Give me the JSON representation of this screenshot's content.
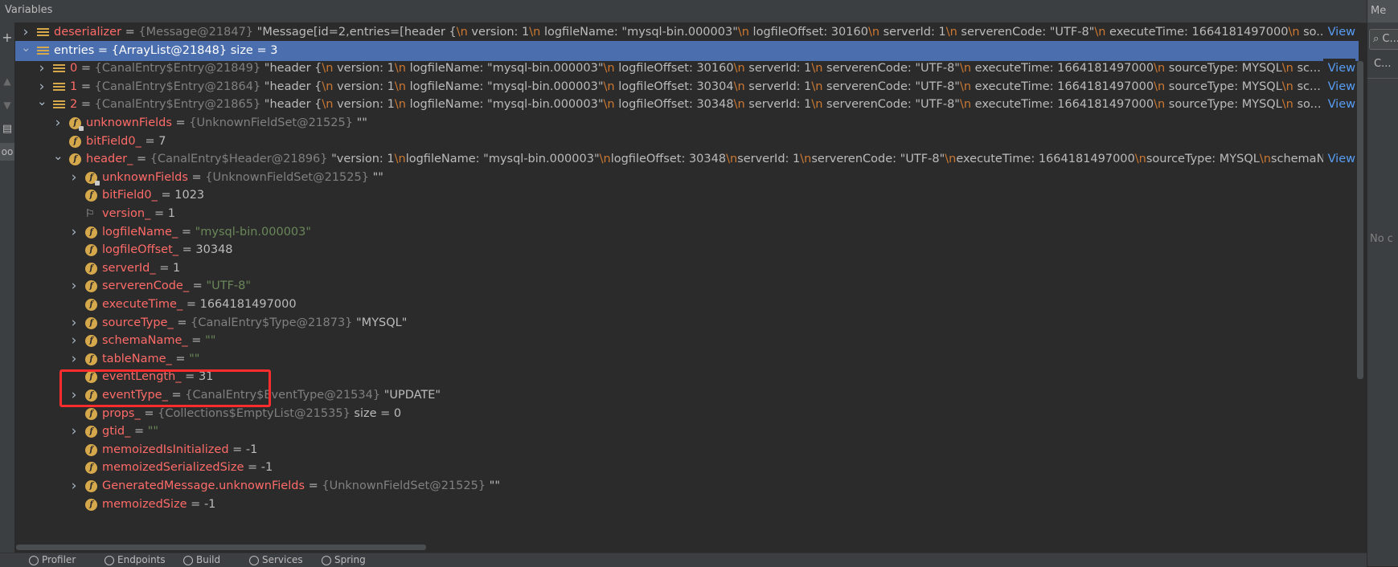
{
  "panel": {
    "title": "Variables"
  },
  "right_panel": {
    "tab": "Me",
    "search_text": "C...",
    "item": "C...",
    "empty_text": "No c"
  },
  "view_link": "View",
  "rows": [
    {
      "indent": 0,
      "arrow": "right",
      "icon": "list",
      "name": "deserializer",
      "ref": "{Message@21847}",
      "val": "\"Message[id=2,entries=[header {\\n  version: 1\\n  logfileName: \"mysql-bin.000003\"\\n  logfileOffset: 30160\\n  serverId: 1\\n  serverenCode: \"UTF-8\"\\n  executeTime: 1664181497000\\n  so...",
      "view": true
    },
    {
      "indent": 0,
      "arrow": "down",
      "icon": "list",
      "name": "entries",
      "ref": "{ArrayList@21848}",
      "val": "size = 3",
      "sel": true
    },
    {
      "indent": 1,
      "arrow": "right",
      "icon": "list",
      "name": "0",
      "ref": "{CanalEntry$Entry@21849}",
      "val": "\"header {\\n  version: 1\\n  logfileName: \"mysql-bin.000003\"\\n  logfileOffset: 30160\\n  serverId: 1\\n  serverenCode: \"UTF-8\"\\n  executeTime: 1664181497000\\n  sourceType: MYSQL\\n  sc...",
      "view": true
    },
    {
      "indent": 1,
      "arrow": "right",
      "icon": "list",
      "name": "1",
      "ref": "{CanalEntry$Entry@21864}",
      "val": "\"header {\\n  version: 1\\n  logfileName: \"mysql-bin.000003\"\\n  logfileOffset: 30304\\n  serverId: 1\\n  serverenCode: \"UTF-8\"\\n  executeTime: 1664181497000\\n  sourceType: MYSQL\\n  sc...",
      "view": true
    },
    {
      "indent": 1,
      "arrow": "down",
      "icon": "list",
      "name": "2",
      "ref": "{CanalEntry$Entry@21865}",
      "val": "\"header {\\n  version: 1\\n  logfileName: \"mysql-bin.000003\"\\n  logfileOffset: 30348\\n  serverId: 1\\n  serverenCode: \"UTF-8\"\\n  executeTime: 1664181497000\\n  sourceType: MYSQL\\n  so...",
      "view": true
    },
    {
      "indent": 2,
      "arrow": "right",
      "icon": "f-lock",
      "name": "unknownFields",
      "ref": "{UnknownFieldSet@21525}",
      "val": "\"\""
    },
    {
      "indent": 2,
      "arrow": "",
      "icon": "f",
      "name": "bitField0_",
      "ref": "",
      "val": "7"
    },
    {
      "indent": 2,
      "arrow": "down",
      "icon": "f",
      "name": "header_",
      "ref": "{CanalEntry$Header@21896}",
      "val": "\"version: 1\\nlogfileName: \"mysql-bin.000003\"\\nlogfileOffset: 30348\\nserverId: 1\\nserverenCode: \"UTF-8\"\\nexecuteTime: 1664181497000\\nsourceType: MYSQL\\nschemaN...",
      "view": true
    },
    {
      "indent": 3,
      "arrow": "right",
      "icon": "f-lock",
      "name": "unknownFields",
      "ref": "{UnknownFieldSet@21525}",
      "val": "\"\""
    },
    {
      "indent": 3,
      "arrow": "",
      "icon": "f",
      "name": "bitField0_",
      "ref": "",
      "val": "1023"
    },
    {
      "indent": 3,
      "arrow": "",
      "icon": "flag",
      "name": "version_",
      "ref": "",
      "val": "1"
    },
    {
      "indent": 3,
      "arrow": "right",
      "icon": "f",
      "name": "logfileName_",
      "ref": "",
      "val": "\"mysql-bin.000003\"",
      "str": true
    },
    {
      "indent": 3,
      "arrow": "",
      "icon": "f",
      "name": "logfileOffset_",
      "ref": "",
      "val": "30348"
    },
    {
      "indent": 3,
      "arrow": "",
      "icon": "f",
      "name": "serverId_",
      "ref": "",
      "val": "1"
    },
    {
      "indent": 3,
      "arrow": "right",
      "icon": "f",
      "name": "serverenCode_",
      "ref": "",
      "val": "\"UTF-8\"",
      "str": true
    },
    {
      "indent": 3,
      "arrow": "",
      "icon": "f",
      "name": "executeTime_",
      "ref": "",
      "val": "1664181497000"
    },
    {
      "indent": 3,
      "arrow": "right",
      "icon": "f",
      "name": "sourceType_",
      "ref": "{CanalEntry$Type@21873}",
      "val": "\"MYSQL\""
    },
    {
      "indent": 3,
      "arrow": "right",
      "icon": "f",
      "name": "schemaName_",
      "ref": "",
      "val": "\"\"",
      "str": true
    },
    {
      "indent": 3,
      "arrow": "right",
      "icon": "f",
      "name": "tableName_",
      "ref": "",
      "val": "\"\"",
      "str": true
    },
    {
      "indent": 3,
      "arrow": "",
      "icon": "f",
      "name": "eventLength_",
      "ref": "",
      "val": "31"
    },
    {
      "indent": 3,
      "arrow": "right",
      "icon": "f",
      "name": "eventType_",
      "ref": "{CanalEntry$EventType@21534}",
      "val": "\"UPDATE\""
    },
    {
      "indent": 3,
      "arrow": "",
      "icon": "f",
      "name": "props_",
      "ref": "{Collections$EmptyList@21535}",
      "val": "size = 0"
    },
    {
      "indent": 3,
      "arrow": "right",
      "icon": "f",
      "name": "gtid_",
      "ref": "",
      "val": "\"\"",
      "str": true
    },
    {
      "indent": 3,
      "arrow": "",
      "icon": "f",
      "name": "memoizedIsInitialized",
      "ref": "",
      "val": "-1"
    },
    {
      "indent": 3,
      "arrow": "",
      "icon": "f",
      "name": "memoizedSerializedSize",
      "ref": "",
      "val": "-1"
    },
    {
      "indent": 3,
      "arrow": "right",
      "icon": "f",
      "name": "GeneratedMessage.unknownFields",
      "ref": "{UnknownFieldSet@21525}",
      "val": "\"\""
    },
    {
      "indent": 3,
      "arrow": "",
      "icon": "f",
      "name": "memoizedSize",
      "ref": "",
      "val": "-1"
    }
  ],
  "status_bar": [
    {
      "label": "Profiler"
    },
    {
      "label": "Endpoints"
    },
    {
      "label": "Build"
    },
    {
      "label": "Services"
    },
    {
      "label": "Spring"
    }
  ]
}
